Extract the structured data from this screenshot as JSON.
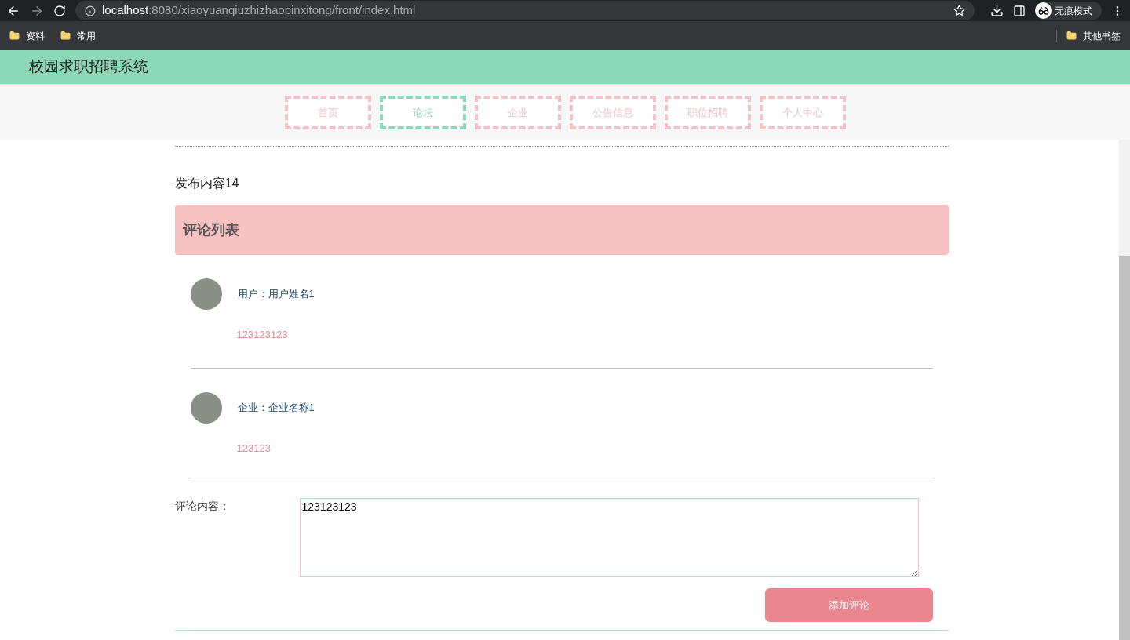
{
  "browser": {
    "url_host": "localhost",
    "url_path": ":8080/xiaoyuanqiuzhizhaopinxitong/front/index.html",
    "profile": "无痕模式",
    "bookmarks": [
      "资料",
      "常用"
    ],
    "other_bookmarks": "其他书签"
  },
  "header": {
    "title": "校园求职招聘系统"
  },
  "nav": [
    {
      "label": "首页",
      "selected": false
    },
    {
      "label": "论坛",
      "selected": true
    },
    {
      "label": "企业",
      "selected": false
    },
    {
      "label": "公告信息",
      "selected": false
    },
    {
      "label": "职位招聘",
      "selected": false
    },
    {
      "label": "个人中心",
      "selected": false
    }
  ],
  "post": {
    "content": "发布内容14"
  },
  "comments": {
    "title": "评论列表",
    "items": [
      {
        "author": "用户：用户姓名1",
        "text": "123123123"
      },
      {
        "author": "企业：企业名称1",
        "text": "123123"
      }
    ]
  },
  "form": {
    "label": "评论内容：",
    "value": "123123123",
    "submit": "添加评论"
  }
}
